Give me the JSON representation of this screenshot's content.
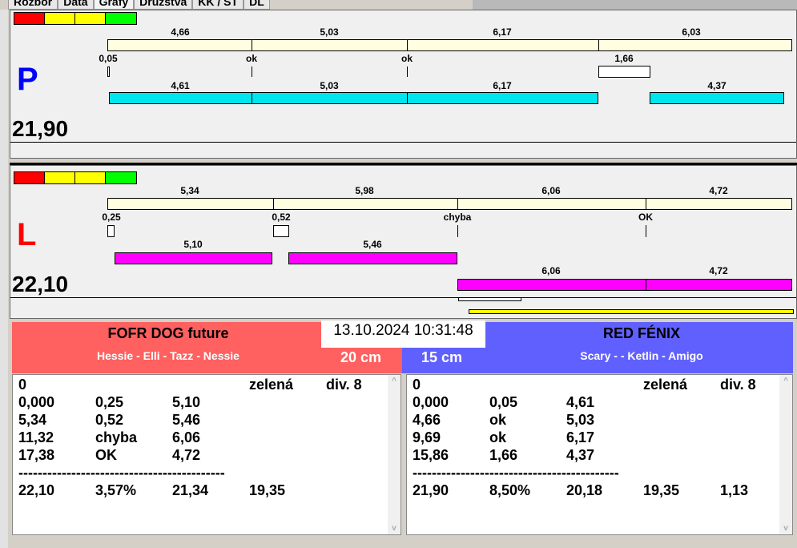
{
  "tabs": [
    "Rozbor",
    "Data",
    "Grafy",
    "Družstva",
    "KK / ST",
    "DL"
  ],
  "colors": {
    "red": "#ff0000",
    "yellow": "#ffff00",
    "green": "#00ff00",
    "track": "#fffee0",
    "cyan": "#00e5ee",
    "magenta": "#ff00ff",
    "team_left": "#ff6060",
    "team_right": "#6060ff"
  },
  "p": {
    "letter": "P",
    "total": "21,90",
    "top_labels": [
      "4,66",
      "5,03",
      "6,17",
      "6,03"
    ],
    "changeover": [
      "0,05",
      "ok",
      "ok",
      "1,66"
    ],
    "run_labels": [
      "4,61",
      "5,03",
      "6,17",
      "4,37"
    ]
  },
  "l": {
    "letter": "L",
    "total": "22,10",
    "top_labels": [
      "5,34",
      "5,98",
      "6,06",
      "4,72"
    ],
    "changeover": [
      "0,25",
      "0,52",
      "chyba",
      "OK"
    ],
    "run_labels": [
      "5,10",
      "5,46"
    ],
    "run2_labels": [
      "6,06",
      "4,72"
    ]
  },
  "datetime": "13.10.2024 10:31:48",
  "left_team": {
    "name": "FOFR DOG future",
    "dogs": "Hessie - Elli - Tazz - Nessie",
    "distance": "20 cm",
    "rows": [
      [
        "0",
        "",
        "",
        "zelená",
        "div. 8"
      ],
      [
        "0,000",
        "0,25",
        "5,10",
        "",
        ""
      ],
      [
        "5,34",
        "0,52",
        "5,46",
        "",
        ""
      ],
      [
        "11,32",
        "chyba",
        "6,06",
        "",
        ""
      ],
      [
        "17,38",
        "OK",
        "4,72",
        "",
        ""
      ],
      [
        "-------------------------------------------",
        "",
        "",
        "",
        ""
      ],
      [
        "22,10",
        "3,57%",
        "21,34",
        "19,35",
        ""
      ]
    ]
  },
  "right_team": {
    "name": "RED FÉNIX",
    "dogs": "Scary -  - Ketlin - Amigo",
    "distance": "15 cm",
    "rows": [
      [
        "0",
        "",
        "",
        "zelená",
        "div. 8"
      ],
      [
        "0,000",
        "0,05",
        "4,61",
        "",
        ""
      ],
      [
        "4,66",
        "ok",
        "5,03",
        "",
        ""
      ],
      [
        "9,69",
        "ok",
        "6,17",
        "",
        ""
      ],
      [
        "15,86",
        "1,66",
        "4,37",
        "",
        ""
      ],
      [
        "-------------------------------------------",
        "",
        "",
        "",
        ""
      ],
      [
        "21,90",
        "8,50%",
        "20,18",
        "19,35",
        "1,13"
      ]
    ]
  }
}
